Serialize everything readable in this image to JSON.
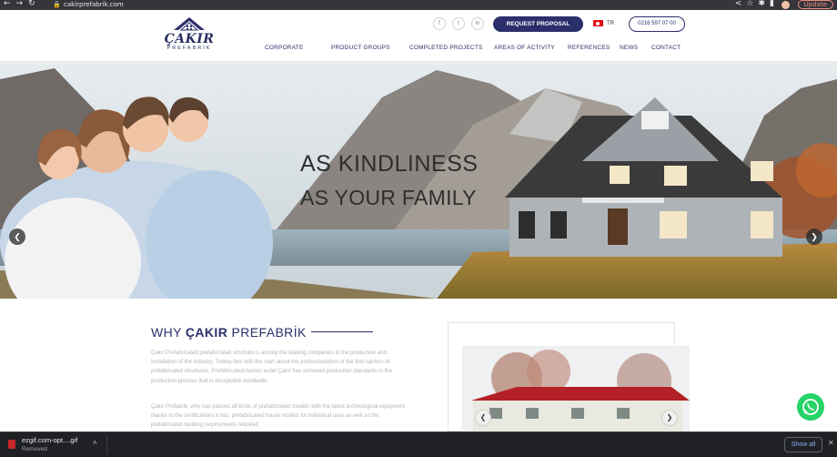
{
  "browser": {
    "url": "cakirprefabrik.com",
    "nav_glyphs": "←→↻",
    "lock_glyph": "🔒",
    "right_glyphs": "<☆✱▮",
    "update_label": "Update"
  },
  "header": {
    "logo": {
      "brand": "ÇAKIR",
      "sub": "PREFABRİK"
    },
    "social": [
      "f",
      "t",
      "in"
    ],
    "request_label": "REQUEST PROPOSAL",
    "lang_label": "TR",
    "phone": "0216 597 07 00",
    "menu": [
      "CORPORATE",
      "PRODUCT GROUPS",
      "COMPLETED PROJECTS",
      "AREAS OF ACTIVITY",
      "REFERENCES",
      "NEWS",
      "CONTACT"
    ]
  },
  "hero": {
    "headline_1": "AS KINDLINESS",
    "headline_2": "AS YOUR FAMILY",
    "prev_glyph": "❮",
    "next_glyph": "❯"
  },
  "about": {
    "title_prefix": "WHY ",
    "title_bold": "ÇAKIR",
    "title_suffix": " PREFABRİK",
    "paragraph_1": "Çakır Prefabricated prefabricated structure is among the leading companies in the production and installation of the industry. Turkey-box with the start about the professionalism of the first carriers of prefabricated structures. Prefabricated homes as/let Çakır has achieved production standards in the production process that is acceptable worldwide.",
    "paragraph_2": "Çakır Prefabrik, who has passed all kinds of prefabricated models with the latest technological equipment thanks to the certifications it has, prefabricated house models for individual uses as well as the prefabricated building requirements required",
    "gallery_prev": "❮",
    "gallery_next": "❯"
  },
  "download_bar": {
    "file_name": "ezgif.com-opt....gif",
    "status": "Removed",
    "chevron": "˄",
    "show_all_label": "Show all",
    "close_glyph": "✕"
  },
  "colors": {
    "brand_navy": "#2b2f6b",
    "whatsapp": "#25d366",
    "chrome_bg": "#35363a"
  }
}
